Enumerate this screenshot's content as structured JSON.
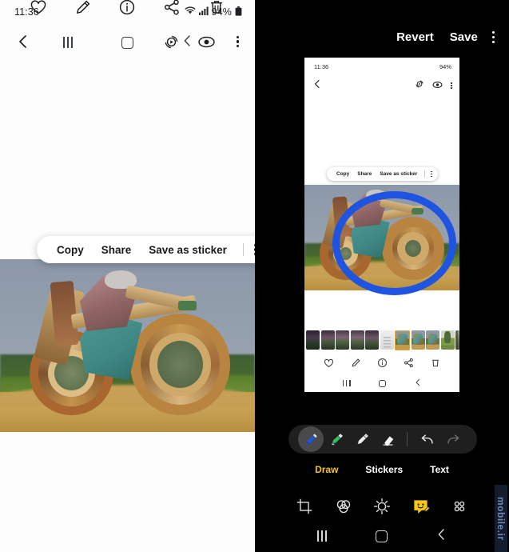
{
  "left": {
    "status": {
      "time": "11:36",
      "battery_pct": "94%",
      "wifi_icon": "wifi-icon",
      "signal_icon": "signal-icon",
      "battery_icon": "battery-icon"
    },
    "topbar": {
      "back_icon": "back-chevron-icon",
      "motion_photo_icon": "motion-photo-icon",
      "visual_search_icon": "eye-icon",
      "more_icon": "kebab-menu-icon"
    },
    "popup": {
      "copy_label": "Copy",
      "share_label": "Share",
      "save_sticker_label": "Save as sticker",
      "more_icon": "kebab-menu-icon"
    },
    "actions": [
      {
        "name": "favorite",
        "icon": "heart-icon"
      },
      {
        "name": "edit",
        "icon": "pencil-icon"
      },
      {
        "name": "info",
        "icon": "info-circle-icon"
      },
      {
        "name": "share",
        "icon": "share-icon"
      },
      {
        "name": "delete",
        "icon": "trash-icon"
      }
    ],
    "filmstrip": [
      {
        "cls": "t-dusk",
        "selected": false
      },
      {
        "cls": "t-dusk2",
        "selected": false
      },
      {
        "cls": "t-dusk3",
        "selected": false
      },
      {
        "cls": "t-dusk3",
        "selected": false
      },
      {
        "cls": "t-dusk2",
        "selected": false
      },
      {
        "cls": "t-doc",
        "selected": false
      },
      {
        "cls": "t-bike",
        "selected": true
      },
      {
        "cls": "t-bike",
        "selected": false
      },
      {
        "cls": "t-bike",
        "selected": false
      },
      {
        "cls": "t-tree",
        "selected": false
      },
      {
        "cls": "t-forest",
        "selected": false
      },
      {
        "cls": "t-forest",
        "selected": false
      },
      {
        "cls": "t-wood",
        "selected": false
      }
    ],
    "navbar": {
      "recents_icon": "recents-icon",
      "home_icon": "home-icon",
      "back_icon": "back-chevron-icon"
    }
  },
  "right": {
    "topbar": {
      "revert_label": "Revert",
      "save_label": "Save",
      "more_icon": "kebab-menu-icon"
    },
    "preview": {
      "status": {
        "time": "11:36",
        "battery_pct": "94%",
        "screenshot_icon": "screenshot-icon"
      },
      "popup": {
        "copy_label": "Copy",
        "share_label": "Share",
        "save_sticker_label": "Save as sticker"
      },
      "annotation": {
        "shape": "circle",
        "color": "#1f54e0",
        "stroke_px": 9
      },
      "filmstrip": [
        {
          "cls": "t-dusk",
          "selected": false
        },
        {
          "cls": "t-dusk2",
          "selected": false
        },
        {
          "cls": "t-dusk3",
          "selected": false
        },
        {
          "cls": "t-dusk3",
          "selected": false
        },
        {
          "cls": "t-dusk2",
          "selected": false
        },
        {
          "cls": "t-doc",
          "selected": false
        },
        {
          "cls": "t-bike",
          "selected": true
        },
        {
          "cls": "t-bike",
          "selected": false
        },
        {
          "cls": "t-bike",
          "selected": false
        },
        {
          "cls": "t-tree",
          "selected": false
        },
        {
          "cls": "t-forest",
          "selected": false
        },
        {
          "cls": "t-forest",
          "selected": false
        },
        {
          "cls": "t-wood",
          "selected": false
        }
      ]
    },
    "pen_tray": [
      {
        "name": "pen-tool",
        "icon": "pen-icon",
        "color": "#1f54e0",
        "active": true
      },
      {
        "name": "highlighter-tool",
        "icon": "highlighter-icon",
        "color": "#2fbf5f",
        "active": false
      },
      {
        "name": "brush-tool",
        "icon": "brush-icon",
        "color": "#e8e8e8",
        "active": false
      },
      {
        "name": "eraser-tool",
        "icon": "eraser-icon",
        "color": "#f2f2f2",
        "active": false
      }
    ],
    "undo_icon": "undo-icon",
    "redo_icon": "redo-icon",
    "mode_tabs": [
      {
        "label": "Draw",
        "active": true
      },
      {
        "label": "Stickers",
        "active": false
      },
      {
        "label": "Text",
        "active": false
      }
    ],
    "edit_tools": [
      {
        "name": "crop-tool",
        "icon": "crop-icon",
        "active": false
      },
      {
        "name": "filter-tool",
        "icon": "filter-icon",
        "active": false
      },
      {
        "name": "adjust-tool",
        "icon": "brightness-icon",
        "active": false
      },
      {
        "name": "decorate-tool",
        "icon": "smiley-draw-icon",
        "active": true
      },
      {
        "name": "more-tools",
        "icon": "grid-dots-icon",
        "active": false
      }
    ],
    "accent_color": "#f5c518",
    "navbar": {
      "recents_icon": "recents-icon",
      "home_icon": "home-icon",
      "back_icon": "back-chevron-icon"
    }
  },
  "watermark": {
    "text": "mobile.ir"
  }
}
